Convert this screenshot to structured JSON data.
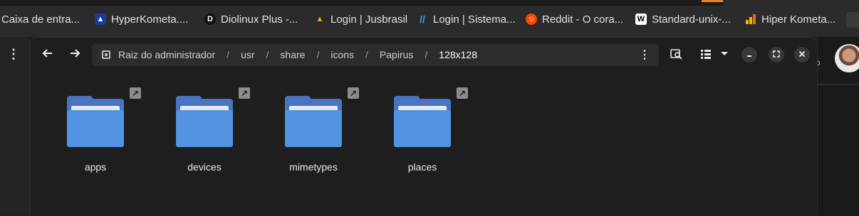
{
  "bookmarks": [
    {
      "label": "Caixa de entra...",
      "icon": "inbox-icon"
    },
    {
      "label": "HyperKometa....",
      "icon": "hyperkometa-icon"
    },
    {
      "label": "Diolinux Plus -...",
      "icon": "diolinux-icon"
    },
    {
      "label": "Login | Jusbrasil",
      "icon": "jusbrasil-icon"
    },
    {
      "label": "Login | Sistema...",
      "icon": "sistema-icon"
    },
    {
      "label": "Reddit - O cora...",
      "icon": "reddit-icon"
    },
    {
      "label": "Standard-unix-...",
      "icon": "wikipedia-icon"
    },
    {
      "label": "Hiper Kometa...",
      "icon": "chart-icon"
    }
  ],
  "filemanager": {
    "path": {
      "root_label": "Raiz do administrador",
      "segments": [
        "usr",
        "share",
        "icons",
        "Papirus"
      ],
      "current": "128x128"
    },
    "items": [
      {
        "name": "apps"
      },
      {
        "name": "devices"
      },
      {
        "name": "mimetypes"
      },
      {
        "name": "places"
      }
    ]
  },
  "colors": {
    "folder_front": "#5294e2",
    "folder_back": "#4a74c1",
    "window_bg": "#1e1e1e",
    "pathbar_bg": "#2c2c2c"
  }
}
